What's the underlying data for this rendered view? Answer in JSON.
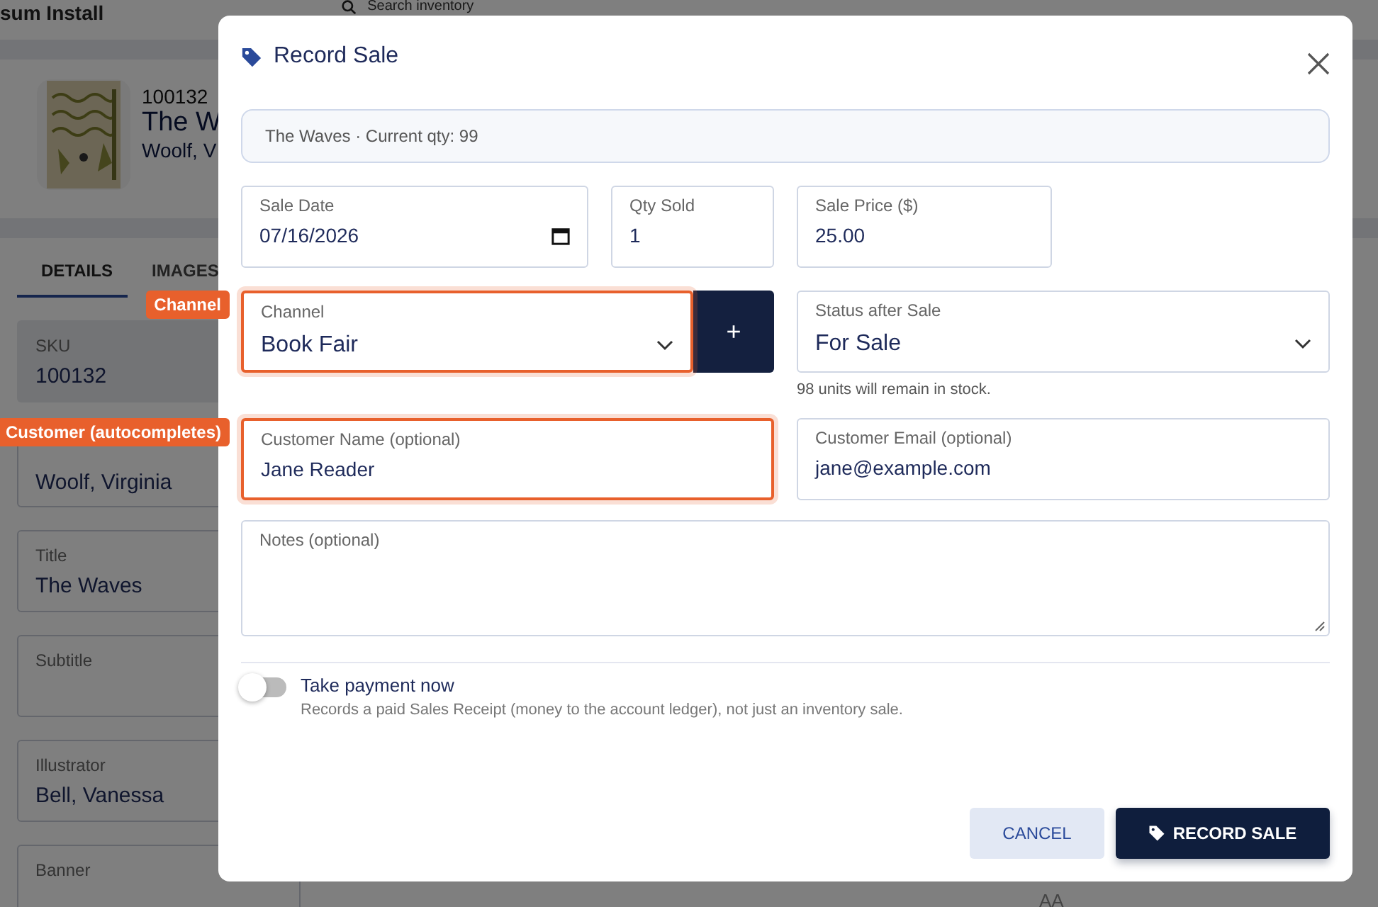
{
  "background": {
    "app_name": "sum Install",
    "search_placeholder": "Search inventory",
    "item": {
      "sku": "100132",
      "title": "The W",
      "author": "Woolf, V"
    },
    "tabs": [
      {
        "label": "DETAILS",
        "selected": true
      },
      {
        "label": "IMAGES",
        "selected": false
      }
    ],
    "fields": [
      {
        "label": "SKU",
        "value": "100132",
        "disabled": true
      },
      {
        "value": "Woolf, Virginia",
        "disabled": false
      },
      {
        "label": "Title",
        "value": "The Waves",
        "disabled": false
      },
      {
        "label": "Subtitle",
        "disabled": false
      },
      {
        "label": "Illustrator",
        "value": "Bell, Vanessa",
        "disabled": false
      },
      {
        "label": "Banner",
        "disabled": false
      }
    ],
    "corner_text": "AA"
  },
  "dialog": {
    "title": "Record Sale",
    "summary": "The Waves · Current qty: 99",
    "sale_date": {
      "label": "Sale Date",
      "value": "07/16/2026"
    },
    "qty_sold": {
      "label": "Qty Sold",
      "value": "1"
    },
    "sale_price": {
      "label": "Sale Price ($)",
      "value": "25.00"
    },
    "channel": {
      "label": "Channel",
      "value": "Book Fair",
      "highlighted": true,
      "callout": "Channel",
      "add_button": "+"
    },
    "status": {
      "label": "Status after Sale",
      "value": "For Sale",
      "hint": "98 units will remain in stock."
    },
    "customer_name": {
      "label": "Customer Name (optional)",
      "value": "Jane Reader",
      "highlighted": true,
      "callout": "Customer (autocompletes)"
    },
    "customer_email": {
      "label": "Customer Email (optional)",
      "value": "jane@example.com",
      "highlighted": false
    },
    "notes": {
      "label": "Notes (optional)"
    },
    "payment": {
      "label": "Take payment now",
      "description": "Records a paid Sales Receipt (money to the account ledger), not just an inventory sale.",
      "on": false
    },
    "buttons": [
      {
        "kind": "secondary",
        "label": "CANCEL"
      },
      {
        "kind": "primary",
        "label": "RECORD SALE"
      }
    ]
  }
}
